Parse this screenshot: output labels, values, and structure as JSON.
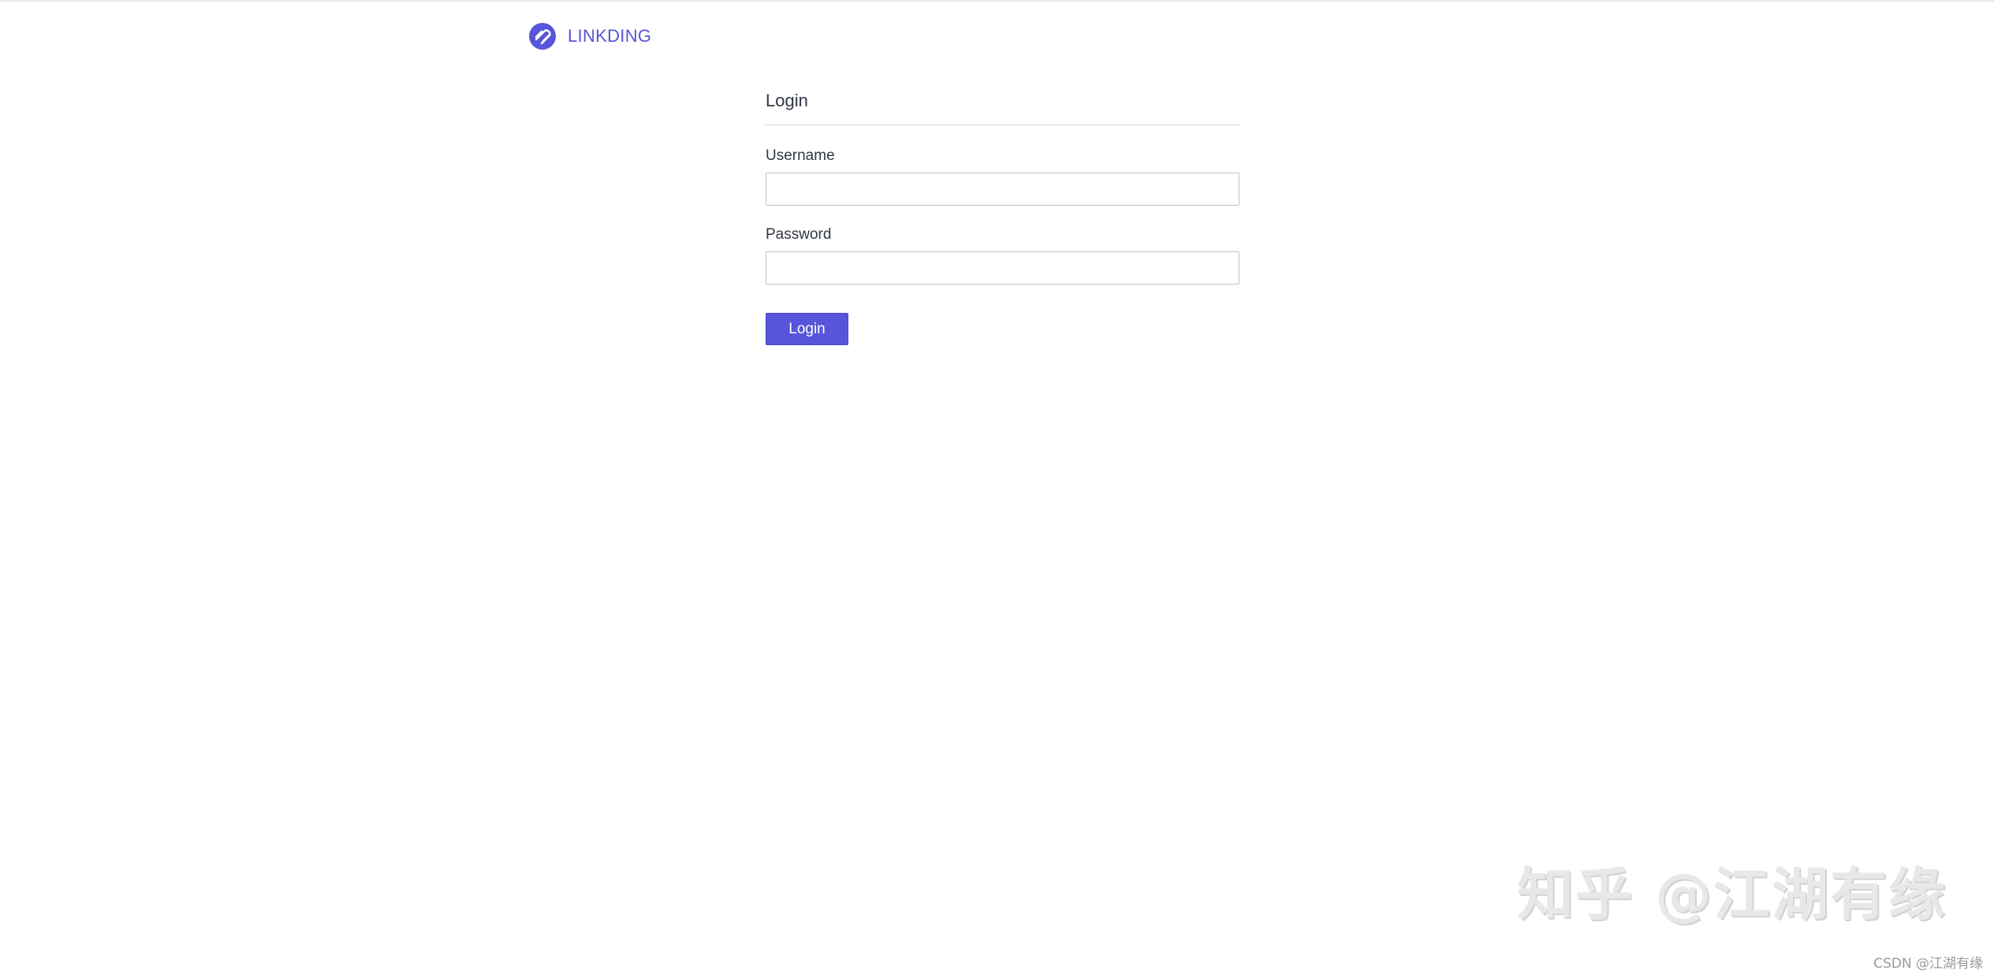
{
  "header": {
    "brand": "LINKDING",
    "logo_icon": "linkding-logo-icon",
    "accent_color": "#5755d9"
  },
  "login": {
    "title": "Login",
    "username_label": "Username",
    "username_value": "",
    "password_label": "Password",
    "password_value": "",
    "submit_label": "Login"
  },
  "watermark": {
    "large": "知乎 @江湖有缘",
    "small": "CSDN @江湖有缘"
  }
}
